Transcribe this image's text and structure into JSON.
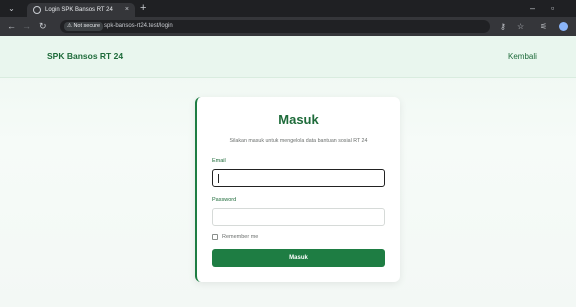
{
  "browser": {
    "tab_title": "Login SPK Bansos RT 24",
    "tab_close": "×",
    "new_tab": "+",
    "not_secure": "⚠ Not secure",
    "url": "spk-bansos-rt24.test/login",
    "icons": [
      "chevron-down-icon",
      "globe-icon",
      "close-icon",
      "plus-icon",
      "back-icon",
      "forward-icon",
      "reload-icon",
      "key-icon",
      "star-icon",
      "extensions-icon",
      "profile-icon"
    ],
    "accent": "#8ab4f8"
  },
  "header": {
    "brand": "SPK Bansos RT 24",
    "back_link": "Kembali"
  },
  "login": {
    "title": "Masuk",
    "subtitle": "Silakan masuk untuk mengelola data bantuan sosial RT 24",
    "email_label": "Email",
    "email_value": "",
    "password_label": "Password",
    "password_value": "",
    "remember_label": "Remember me",
    "submit_label": "Masuk"
  },
  "colors": {
    "brand_green": "#1e6b3a",
    "button_green": "#1e7d43",
    "page_bg": "#eef7f1"
  }
}
